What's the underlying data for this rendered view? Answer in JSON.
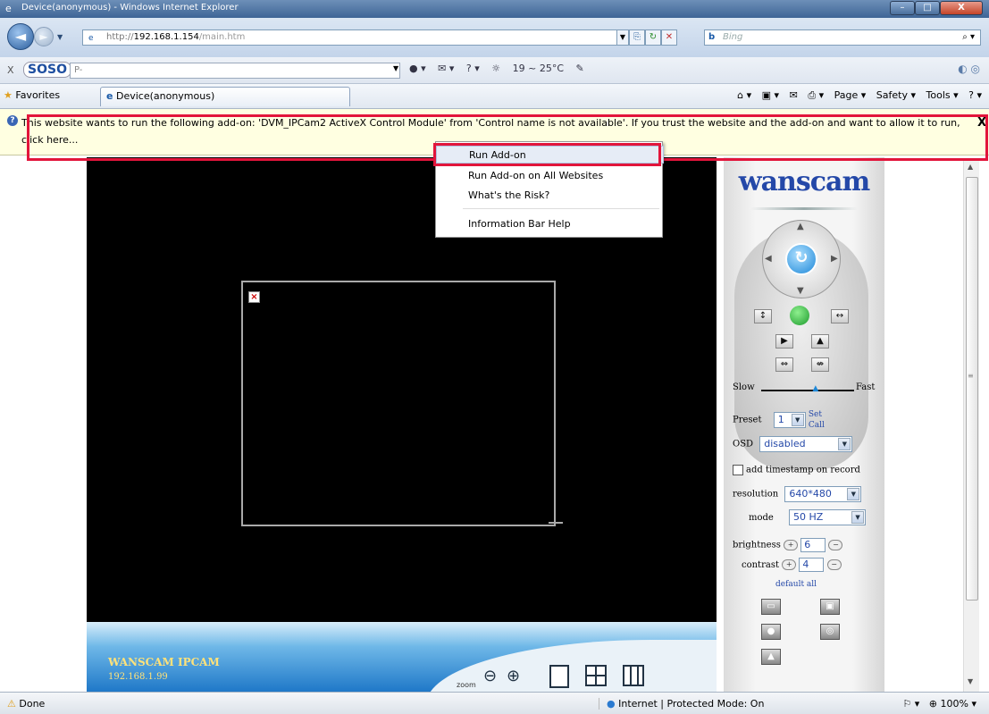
{
  "window": {
    "title": "Device(anonymous) - Windows Internet Explorer",
    "min": "–",
    "max": "□",
    "close": "X"
  },
  "nav": {
    "url_protocol": "http://",
    "url_host": "192.168.1.154",
    "url_path": "/main.htm",
    "search_placeholder": "Bing"
  },
  "soso": {
    "close": "X",
    "logo": "SOSO",
    "placeholder": "P-",
    "weather": "19 ~ 25°C"
  },
  "favorites": {
    "label": "Favorites",
    "tab_label": "Device(anonymous)",
    "commands": [
      "Page ▾",
      "Safety ▾",
      "Tools ▾"
    ]
  },
  "infobar": {
    "message": "This website wants to run the following add-on: 'DVM_IPCam2 ActiveX Control Module' from 'Control name is not available'. If you trust the website and the add-on and want to allow it to run, click here...",
    "close": "X"
  },
  "context_menu": {
    "items": [
      "Run Add-on",
      "Run Add-on on All Websites",
      "What's the Risk?",
      "Information Bar Help"
    ]
  },
  "camera": {
    "footer_brand": "WANSCAM IPCAM",
    "footer_ip": "192.168.1.99",
    "zoom_label": "zoom"
  },
  "panel": {
    "logo": "wanscam",
    "speed_slow": "Slow",
    "speed_fast": "Fast",
    "speed_level": 0.6,
    "preset_label": "Preset",
    "preset_value": "1",
    "preset_set": "Set",
    "preset_call": "Call",
    "osd_label": "OSD",
    "osd_value": "disabled",
    "timestamp_label": "add timestamp on record",
    "resolution_label": "resolution",
    "resolution_value": "640*480",
    "mode_label": "mode",
    "mode_value": "50 HZ",
    "brightness_label": "brightness",
    "brightness_value": "6",
    "contrast_label": "contrast",
    "contrast_value": "4",
    "default_all": "default all"
  },
  "status": {
    "done": "Done",
    "zone": "Internet | Protected Mode: On",
    "zoom": "100%"
  }
}
